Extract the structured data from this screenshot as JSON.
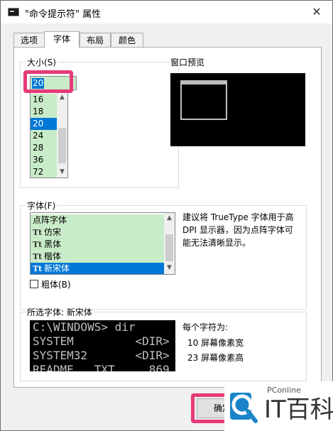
{
  "window": {
    "title": "\"命令提示符\" 属性",
    "close_glyph": "✕"
  },
  "tabs": [
    {
      "label": "选项"
    },
    {
      "label": "字体"
    },
    {
      "label": "布局"
    },
    {
      "label": "颜色"
    }
  ],
  "size_group": {
    "label": "大小(S)",
    "input_value": "20",
    "items": [
      "16",
      "18",
      "20",
      "24",
      "28",
      "36",
      "72"
    ],
    "selected": "20"
  },
  "preview": {
    "label": "窗口预览"
  },
  "font_group": {
    "label": "字体(F)",
    "items": [
      {
        "label": "点阵字体",
        "icon": ""
      },
      {
        "label": "仿宋",
        "icon": "Tt"
      },
      {
        "label": "黑体",
        "icon": "Tt"
      },
      {
        "label": "楷体",
        "icon": "Tt"
      },
      {
        "label": "新宋体",
        "icon": "Tt"
      }
    ],
    "selected": "新宋体",
    "hint": [
      "建议将 TrueType 字体用于高",
      "DPI 显示器，因为点阵字体可",
      "能无法清晰显示。"
    ],
    "bold_label": "粗体(B)",
    "bold_checked": false
  },
  "selected_font": {
    "label": "所选字体: 新宋体",
    "console_lines": [
      "C:\\WINDOWS> dir",
      "SYSTEM         <DIR>",
      "SYSTEM32       <DIR>",
      "README   TXT     869"
    ],
    "char_label": "每个字符为:",
    "width_text": "10 屏幕像素宽",
    "height_text": "23 屏幕像素高"
  },
  "buttons": {
    "ok_label": "确定"
  },
  "watermark": {
    "brand": "PConline",
    "logo_text": "IT百科"
  },
  "colors": {
    "accent": "#0078d7",
    "highlight": "#e63a78",
    "list_bg": "#c8ecc8",
    "watermark_blue": "#1a84c8"
  }
}
